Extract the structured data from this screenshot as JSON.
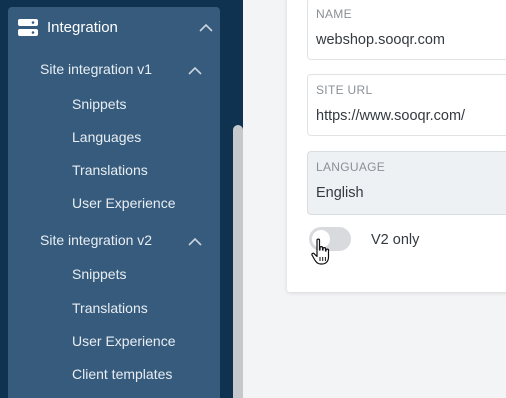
{
  "sidebar": {
    "group": {
      "label": "Integration",
      "icon": "server-icon",
      "expanded": true
    },
    "sections": [
      {
        "label": "Site integration v1",
        "expanded": true,
        "items": [
          "Snippets",
          "Languages",
          "Translations",
          "User Experience"
        ]
      },
      {
        "label": "Site integration v2",
        "expanded": true,
        "items": [
          "Snippets",
          "Translations",
          "User Experience",
          "Client templates"
        ]
      }
    ]
  },
  "form": {
    "name": {
      "label": "NAME",
      "value": "webshop.sooqr.com"
    },
    "site_url": {
      "label": "SITE URL",
      "value": "https://www.sooqr.com/"
    },
    "language": {
      "label": "LANGUAGE",
      "value": "English"
    },
    "v2_toggle": {
      "label": "V2 only",
      "checked": false
    }
  },
  "colors": {
    "sidebar_bg": "#0e3250",
    "nav_panel_bg": "#365b7c",
    "toggle_off": "#d8dadd"
  }
}
